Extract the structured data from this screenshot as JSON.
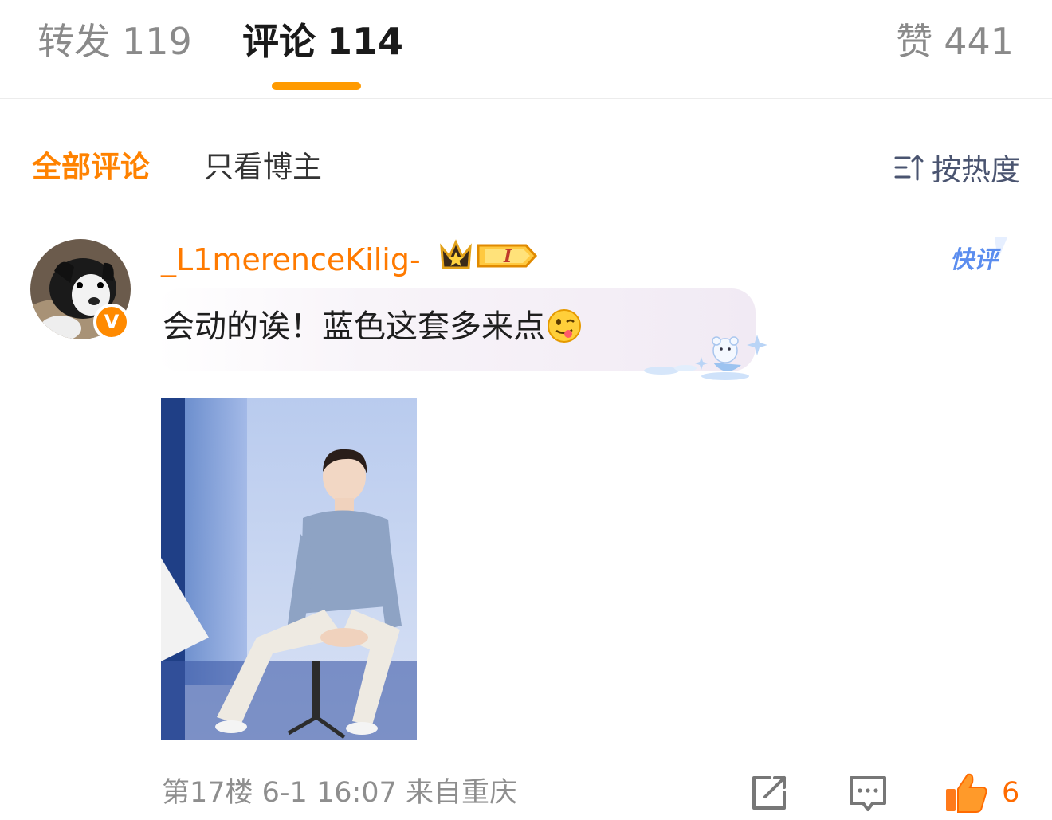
{
  "tabs": {
    "repost": {
      "label": "转发",
      "count": "119"
    },
    "comment": {
      "label": "评论",
      "count": "114"
    },
    "like": {
      "label": "赞",
      "count": "441"
    }
  },
  "filters": {
    "all": "全部评论",
    "host_only": "只看博主",
    "sort": "按热度"
  },
  "comment": {
    "username": "_L1merenceKilig-",
    "badge_level": "I",
    "quick_tag": "快评",
    "text": "会动的诶！蓝色这套多来点",
    "floor_info": "第17楼 6-1 16:07 来自重庆",
    "like_count": "6",
    "verified_badge": "V"
  },
  "colors": {
    "accent": "#ff8200",
    "tab_indicator": "#ff9a00",
    "username": "#ff7a00",
    "muted": "#8e8e8e"
  },
  "icons": [
    "sort-icon",
    "crown-badge-icon",
    "quick-comment-icon",
    "emoji-tongue-icon",
    "share-icon",
    "reply-icon",
    "thumbs-up-icon"
  ]
}
